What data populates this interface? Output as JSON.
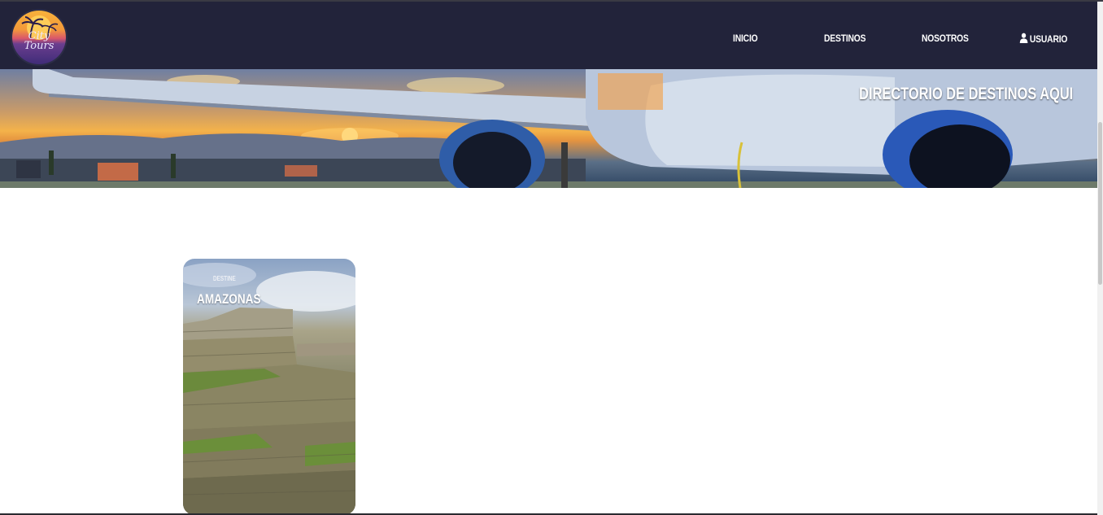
{
  "brand": {
    "logo_text": "City Tours"
  },
  "nav": {
    "items": [
      {
        "label": "INICIO"
      },
      {
        "label": "DESTINOS"
      },
      {
        "label": "NOSOTROS"
      },
      {
        "label": "USUARIO",
        "icon": "user-icon"
      }
    ]
  },
  "hero": {
    "title": "DIRECTORIO DE DESTINOS AQUI"
  },
  "cards": [
    {
      "label": "DESTINE",
      "title": "AMAZONAS"
    }
  ],
  "colors": {
    "navbar": "#22233a",
    "page": "#ffffff",
    "text_light": "#ffffff"
  }
}
